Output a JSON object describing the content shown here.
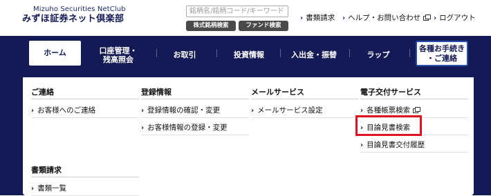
{
  "logo": {
    "en": "Mizuho Securities NetClub",
    "ja": "みずほ証券ネット倶楽部"
  },
  "search": {
    "placeholder": "銘柄名/銘柄コード/キーワード",
    "value": "",
    "stock_button": "株式銘柄検索",
    "fund_button": "ファンド検索"
  },
  "header_links": {
    "documents": "書類請求",
    "help": "ヘルプ・お問い合わせ",
    "logout": "ログアウト"
  },
  "nav": {
    "home": "ホーム",
    "account": "口座管理・\n残高照会",
    "trade": "お取引",
    "invest_info": "投資情報",
    "deposit": "入出金・振替",
    "wrap": "ラップ",
    "procedures": "各種お手続き\n・ご連絡"
  },
  "menu": {
    "contact": {
      "title": "ご連絡",
      "items": [
        "お客様へのご連絡"
      ]
    },
    "registration": {
      "title": "登録情報",
      "items": [
        "登録情報の確認・変更",
        "お客様情報の登録・変更"
      ]
    },
    "mail": {
      "title": "メールサービス",
      "items": [
        "メールサービス設定"
      ]
    },
    "electronic": {
      "title": "電子交付サービス",
      "items": [
        "各種帳票検索",
        "目論見書検索",
        "目論見書交付履歴"
      ]
    },
    "documents": {
      "title": "書類請求",
      "items": [
        "書類一覧"
      ]
    }
  },
  "highlight_color": "#e0141e",
  "nav_color": "#141a55"
}
